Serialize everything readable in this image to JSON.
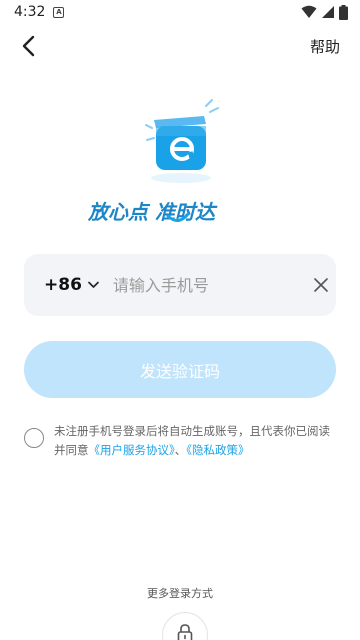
{
  "status_bar": {
    "time": "4:32",
    "notification_badge": "A"
  },
  "header": {
    "help_label": "帮助"
  },
  "brand": {
    "slogan": "放心点 准时达"
  },
  "phone": {
    "country_code": "+86",
    "placeholder": "请输入手机号"
  },
  "send_button_label": "发送验证码",
  "agreement": {
    "prefix": "未注册手机号登录后将自动生成账号，且代表你已阅读并同意",
    "user_agreement": "《用户服务协议》",
    "separator": "、",
    "privacy_policy": "《隐私政策》"
  },
  "more_login_label": "更多登录方式",
  "icons": {
    "back": "back-arrow-icon",
    "chevron": "chevron-down-icon",
    "clear": "close-icon",
    "lock": "lock-icon",
    "wifi": "wifi-icon",
    "signal": "signal-icon",
    "battery": "battery-icon"
  },
  "colors": {
    "brand_blue": "#1aa2e8",
    "button_disabled": "#bfe4fb",
    "field_bg": "#f2f4f7"
  }
}
